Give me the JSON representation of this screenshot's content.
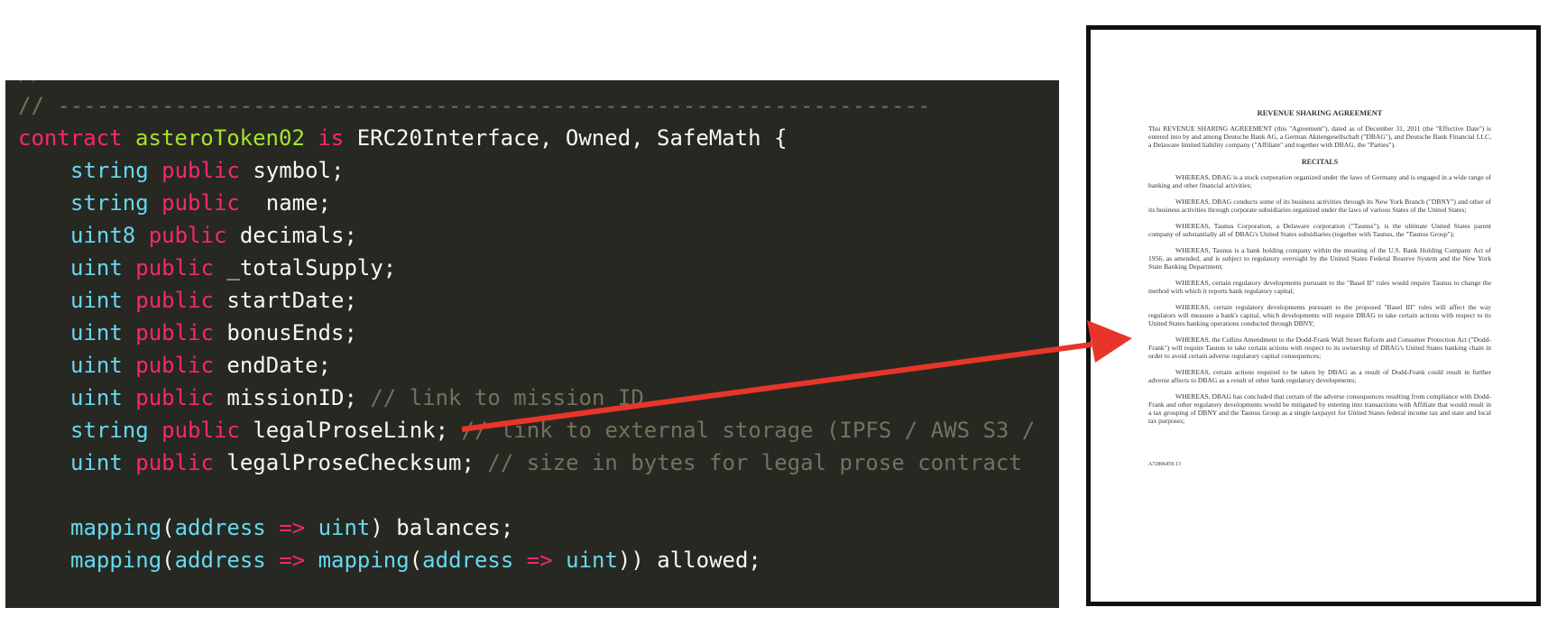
{
  "code": {
    "clipped_top_line": "// ...",
    "lines": [
      [
        {
          "t": "// -------------------------------------------------------------------",
          "c": "comment"
        }
      ],
      [
        {
          "t": "contract ",
          "c": "keyword"
        },
        {
          "t": "asteroToken02 ",
          "c": "name"
        },
        {
          "t": "is ",
          "c": "keyword"
        },
        {
          "t": "ERC20Interface, Owned, SafeMath {",
          "c": "plain"
        }
      ],
      [
        {
          "t": "string ",
          "c": "type"
        },
        {
          "t": "public ",
          "c": "keyword"
        },
        {
          "t": "symbol;",
          "c": "plain"
        }
      ],
      [
        {
          "t": "string ",
          "c": "type"
        },
        {
          "t": "public ",
          "c": "keyword"
        },
        {
          "t": " name;",
          "c": "plain"
        }
      ],
      [
        {
          "t": "uint8 ",
          "c": "type"
        },
        {
          "t": "public ",
          "c": "keyword"
        },
        {
          "t": "decimals;",
          "c": "plain"
        }
      ],
      [
        {
          "t": "uint ",
          "c": "type"
        },
        {
          "t": "public ",
          "c": "keyword"
        },
        {
          "t": "_totalSupply;",
          "c": "plain"
        }
      ],
      [
        {
          "t": "uint ",
          "c": "type"
        },
        {
          "t": "public ",
          "c": "keyword"
        },
        {
          "t": "startDate;",
          "c": "plain"
        }
      ],
      [
        {
          "t": "uint ",
          "c": "type"
        },
        {
          "t": "public ",
          "c": "keyword"
        },
        {
          "t": "bonusEnds;",
          "c": "plain"
        }
      ],
      [
        {
          "t": "uint ",
          "c": "type"
        },
        {
          "t": "public ",
          "c": "keyword"
        },
        {
          "t": "endDate;",
          "c": "plain"
        }
      ],
      [
        {
          "t": "uint ",
          "c": "type"
        },
        {
          "t": "public ",
          "c": "keyword"
        },
        {
          "t": "missionID; ",
          "c": "plain"
        },
        {
          "t": "// link to mission ID",
          "c": "comment"
        }
      ],
      [
        {
          "t": "string ",
          "c": "type"
        },
        {
          "t": "public ",
          "c": "keyword"
        },
        {
          "t": "legalProseLink; ",
          "c": "plain"
        },
        {
          "t": "// link to external storage (IPFS / AWS S3 /",
          "c": "comment"
        }
      ],
      [
        {
          "t": "uint ",
          "c": "type"
        },
        {
          "t": "public ",
          "c": "keyword"
        },
        {
          "t": "legalProseChecksum; ",
          "c": "plain"
        },
        {
          "t": "// size in bytes for legal prose contract",
          "c": "comment"
        }
      ],
      [],
      [
        {
          "t": "mapping",
          "c": "type"
        },
        {
          "t": "(",
          "c": "plain"
        },
        {
          "t": "address ",
          "c": "type"
        },
        {
          "t": "=> ",
          "c": "keyword"
        },
        {
          "t": "uint",
          "c": "type"
        },
        {
          "t": ") balances;",
          "c": "plain"
        }
      ],
      [
        {
          "t": "mapping",
          "c": "type"
        },
        {
          "t": "(",
          "c": "plain"
        },
        {
          "t": "address ",
          "c": "type"
        },
        {
          "t": "=> ",
          "c": "keyword"
        },
        {
          "t": "mapping",
          "c": "type"
        },
        {
          "t": "(",
          "c": "plain"
        },
        {
          "t": "address ",
          "c": "type"
        },
        {
          "t": "=> ",
          "c": "keyword"
        },
        {
          "t": "uint",
          "c": "type"
        },
        {
          "t": ")) allowed;",
          "c": "plain"
        }
      ]
    ],
    "colors": {
      "background": "#272822",
      "comment": "#75715e",
      "keyword": "#f92672",
      "type": "#66d9ef",
      "name": "#a6e22e",
      "plain": "#f8f8f2"
    }
  },
  "document": {
    "title": "REVENUE SHARING AGREEMENT",
    "intro": "This REVENUE SHARING AGREEMENT (this \"Agreement\"), dated as of December 31, 2011 (the \"Effective Date\") is entered into by and among Deutsche Bank AG, a German Aktiengesellschaft (\"DBAG\"), and Deutsche Bank Financial LLC, a Delaware limited liability company (\"Affiliate\" and together with DBAG, the \"Parties\").",
    "heading": "RECITALS",
    "recitals": [
      "WHEREAS, DBAG is a stock corporation organized under the laws of Germany and is engaged in a wide range of banking and other financial activities;",
      "WHEREAS, DBAG conducts some of its business activities through its New York Branch (\"DBNY\") and other of its business activities through corporate subsidiaries organized under the laws of various States of the United States;",
      "WHEREAS, Taunus Corporation, a Delaware corporation (\"Taunus\"), is the ultimate United States parent company of substantially all of DBAG's United States subsidiaries (together with Taunus, the \"Taunus Group\");",
      "WHEREAS, Taunus is a bank holding company within the meaning of the U.S. Bank Holding Company Act of 1956, as amended, and is subject to regulatory oversight by the United States Federal Reserve System and the New York State Banking Department;",
      "WHEREAS, certain regulatory developments pursuant to the \"Basel II\" rules would require Taunus to change the method with which it reports bank regulatory capital;",
      "WHEREAS, certain regulatory developments pursuant to the proposed \"Basel III\" rules will affect the way regulators will measure a bank's capital, which developments will require DBAG to take certain actions with respect to its United States banking operations conducted through DBNY;",
      "WHEREAS, the Collins Amendment to the Dodd-Frank Wall Street Reform and Consumer Protection Act (\"Dodd-Frank\") will require Taunus to take certain actions with respect to its ownership of DBAG's United States banking chain in order to avoid certain adverse regulatory capital consequences;",
      "WHEREAS, certain actions required to be taken by DBAG as a result of Dodd-Frank could result in further adverse affects to DBAG as a result of other bank regulatory developments;",
      "WHEREAS, DBAG has concluded that certain of the adverse consequences resulting from compliance with Dodd-Frank and other regulatory developments would be mitigated by entering into transactions with Affiliate that would result in a tax grouping of DBNY and the Taunus Group as a single taxpayer for United States federal income tax and state and local tax purposes;"
    ],
    "footer": "A72806459.13"
  },
  "arrow_color": "#e8352a"
}
